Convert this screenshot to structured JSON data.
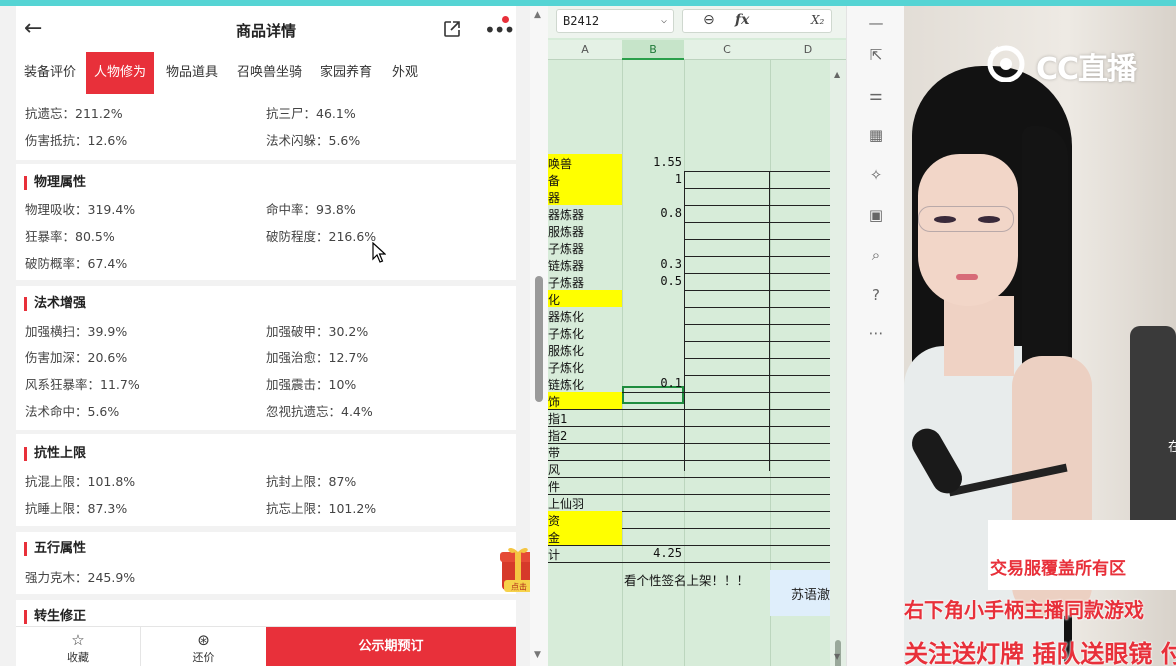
{
  "app": {
    "title": "商品详情",
    "tabs": [
      "装备评价",
      "人物修为",
      "物品道具",
      "召唤兽坐骑",
      "家园养育",
      "外观"
    ],
    "active_tab": 1,
    "top_attrs": [
      {
        "label": "抗遗忘：211.2%",
        "col": 0
      },
      {
        "label": "抗三尸：46.1%",
        "col": 1
      },
      {
        "label": "伤害抵抗：12.6%",
        "col": 0
      },
      {
        "label": "法术闪躲：5.6%",
        "col": 1
      }
    ],
    "sections": [
      {
        "title": "物理属性",
        "attrs": [
          "物理吸收：319.4%",
          "命中率：93.8%",
          "狂暴率：80.5%",
          "破防程度：216.6%",
          "破防概率：67.4%"
        ]
      },
      {
        "title": "法术增强",
        "attrs": [
          "加强横扫：39.9%",
          "加强破甲：30.2%",
          "伤害加深：20.6%",
          "加强治愈：12.7%",
          "风系狂暴率：11.7%",
          "加强震击：10%",
          "法术命中：5.6%",
          "忽视抗遗忘：4.4%"
        ]
      },
      {
        "title": "抗性上限",
        "attrs": [
          "抗混上限：101.8%",
          "抗封上限：87%",
          "抗睡上限：87.3%",
          "抗忘上限：101.2%"
        ]
      },
      {
        "title": "五行属性",
        "attrs": [
          "强力克木：245.9%"
        ]
      },
      {
        "title": "转生修正",
        "attrs": []
      }
    ],
    "bottom": {
      "fav": "收藏",
      "bargain": "还价",
      "primary": "公示期预订"
    },
    "gift_label": "点击"
  },
  "sheet": {
    "namebox": "B2412",
    "fx": "fx",
    "columns": [
      "A",
      "B",
      "C",
      "D"
    ],
    "rows": [
      {
        "a": "唤兽",
        "b": "1.55",
        "yellow": true
      },
      {
        "a": "备",
        "b": "1",
        "yellow": true
      },
      {
        "a": "器",
        "b": "",
        "yellow": true
      },
      {
        "a": "器炼器",
        "b": "0.8",
        "yellow": false
      },
      {
        "a": "服炼器",
        "b": "",
        "yellow": false
      },
      {
        "a": "子炼器",
        "b": "",
        "yellow": false
      },
      {
        "a": "链炼器",
        "b": "0.3",
        "yellow": false
      },
      {
        "a": "子炼器",
        "b": "0.5",
        "yellow": false
      },
      {
        "a": "化",
        "b": "",
        "yellow": true
      },
      {
        "a": "器炼化",
        "b": "",
        "yellow": false
      },
      {
        "a": "子炼化",
        "b": "",
        "yellow": false
      },
      {
        "a": "服炼化",
        "b": "",
        "yellow": false
      },
      {
        "a": "子炼化",
        "b": "",
        "yellow": false
      },
      {
        "a": "链炼化",
        "b": "0.1",
        "yellow": false
      },
      {
        "a": "饰",
        "b": "",
        "yellow": true
      },
      {
        "a": "指1",
        "b": "",
        "yellow": false
      },
      {
        "a": "指2",
        "b": "",
        "yellow": false
      },
      {
        "a": "带",
        "b": "",
        "yellow": false
      },
      {
        "a": "风",
        "b": "",
        "yellow": false
      },
      {
        "a": "件",
        "b": "",
        "yellow": false
      },
      {
        "a": "上仙羽",
        "b": "",
        "yellow": false
      },
      {
        "a": "资",
        "b": "",
        "yellow": true
      },
      {
        "a": "金",
        "b": "",
        "yellow": true
      },
      {
        "a": "计",
        "b": "4.25",
        "yellow": false
      }
    ],
    "footer_text": "看个性签名上架！！！",
    "note": "苏语澈"
  },
  "stream": {
    "logo": "CC直播",
    "banner": "交易服覆盖所有区",
    "ticker1": "右下角小手柄主播同款游戏",
    "ticker2": "关注送灯牌 插队送眼镜 付",
    "edge": "在"
  }
}
